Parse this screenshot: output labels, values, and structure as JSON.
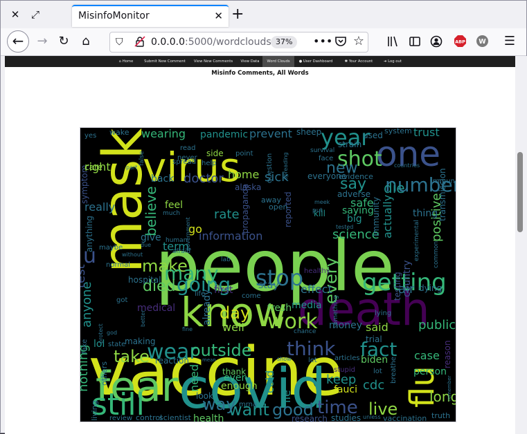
{
  "browser": {
    "tab_title": "MisinfoMonitor",
    "url_host": "0.0.0.0",
    "url_path": ":5000/wordclouds",
    "zoom": "37%",
    "icons": {
      "close_window": "close-icon",
      "restore": "restore-icon",
      "tab_close": "close-icon",
      "new_tab": "plus-icon",
      "back": "back-arrow-icon",
      "forward": "forward-arrow-icon",
      "reload": "reload-icon",
      "home": "home-icon",
      "shield": "shield-icon",
      "insecure": "insecure-lock-icon",
      "more": "more-dots-icon",
      "pocket": "pocket-icon",
      "bookmark": "star-icon",
      "library": "library-icon",
      "sidebar": "sidebar-icon",
      "account": "account-icon",
      "adblock": "adblock-icon",
      "extension": "extension-w-icon",
      "menu": "hamburger-menu-icon"
    },
    "adblock_label": "ABP",
    "extension_label": "W"
  },
  "site_nav": {
    "items": [
      {
        "label": "Home",
        "icon": "home-icon"
      },
      {
        "label": "Submit New Comment"
      },
      {
        "label": "View New Comments"
      },
      {
        "label": "View Data"
      },
      {
        "label": "Word Clouds",
        "active": true
      },
      {
        "label": "User Dashboard",
        "icon": "user-icon"
      },
      {
        "label": "Your Account",
        "icon": "gear-icon"
      },
      {
        "label": "Log out",
        "icon": "logout-icon"
      }
    ]
  },
  "page": {
    "heading": "Misinfo Comments, All Words"
  },
  "wordcloud": {
    "background": "#000000",
    "palette": [
      "#d2e21b",
      "#8fd744",
      "#35b779",
      "#21918c",
      "#2c728e",
      "#3b528b",
      "#472d7b",
      "#440154"
    ],
    "words": [
      {
        "text": "vaccine",
        "color": "#d2e21b"
      },
      {
        "text": "people",
        "color": "#7ad151"
      },
      {
        "text": "mask",
        "color": "#d2e21b"
      },
      {
        "text": "covid",
        "color": "#21918c"
      },
      {
        "text": "death",
        "color": "#440154"
      },
      {
        "text": "virus",
        "color": "#d2e21b"
      },
      {
        "text": "one",
        "color": "#3b528b"
      },
      {
        "text": "fear",
        "color": "#5ec962"
      },
      {
        "text": "know",
        "color": "#8fd744"
      },
      {
        "text": "still",
        "color": "#35b779"
      },
      {
        "text": "flu",
        "color": "#d2e21b"
      },
      {
        "text": "getting",
        "color": "#35b779"
      },
      {
        "text": "stop",
        "color": "#2c728e"
      },
      {
        "text": "going",
        "color": "#21918c"
      },
      {
        "text": "year",
        "color": "#21918c"
      },
      {
        "text": "shot",
        "color": "#5ec962"
      },
      {
        "text": "number",
        "color": "#2c728e"
      },
      {
        "text": "work",
        "color": "#8fd744"
      },
      {
        "text": "wear",
        "color": "#21918c"
      },
      {
        "text": "outside",
        "color": "#35b779"
      },
      {
        "text": "think",
        "color": "#3b528b"
      },
      {
        "text": "fact",
        "color": "#21918c"
      },
      {
        "text": "time",
        "color": "#3b528b"
      },
      {
        "text": "live",
        "color": "#8fd744"
      },
      {
        "text": "want",
        "color": "#21918c"
      },
      {
        "text": "good",
        "color": "#2c728e"
      },
      {
        "text": "way",
        "color": "#2c728e"
      },
      {
        "text": "long",
        "color": "#8fd744"
      },
      {
        "text": "make",
        "color": "#8fd744"
      },
      {
        "text": "many",
        "color": "#35b779"
      },
      {
        "text": "died",
        "color": "#5ec962"
      },
      {
        "text": "day",
        "color": "#d2e21b"
      },
      {
        "text": "take",
        "color": "#8fd744"
      },
      {
        "text": "new",
        "color": "#2c728e"
      },
      {
        "text": "say",
        "color": "#21918c"
      },
      {
        "text": "die",
        "color": "#21918c"
      },
      {
        "text": "believe",
        "color": "#35b779"
      },
      {
        "text": "right",
        "color": "#8fd744"
      },
      {
        "text": "sick",
        "color": "#2c728e"
      },
      {
        "text": "doctor",
        "color": "#3b528b"
      },
      {
        "text": "home",
        "color": "#8fd744"
      },
      {
        "text": "rate",
        "color": "#21918c"
      },
      {
        "text": "information",
        "color": "#3b528b"
      },
      {
        "text": "science",
        "color": "#35b779"
      },
      {
        "text": "every",
        "color": "#5ec962"
      },
      {
        "text": "keep",
        "color": "#21918c"
      },
      {
        "text": "safe",
        "color": "#35b779"
      },
      {
        "text": "positive",
        "color": "#5ec962"
      },
      {
        "text": "pandemic",
        "color": "#21918c"
      },
      {
        "text": "prevent",
        "color": "#2c728e"
      },
      {
        "text": "wearing",
        "color": "#35b779"
      },
      {
        "text": "trust",
        "color": "#21918c"
      },
      {
        "text": "cdc",
        "color": "#21918c"
      },
      {
        "text": "public",
        "color": "#35b779"
      },
      {
        "text": "case",
        "color": "#35b779"
      },
      {
        "text": "anyone",
        "color": "#21918c"
      },
      {
        "text": "nothing",
        "color": "#35b779"
      },
      {
        "text": "health",
        "color": "#5ec962"
      },
      {
        "text": "research",
        "color": "#3b528b"
      },
      {
        "text": "studies",
        "color": "#2c728e"
      },
      {
        "text": "vaccination",
        "color": "#2c728e"
      },
      {
        "text": "control",
        "color": "#2c728e"
      },
      {
        "text": "scientist",
        "color": "#2c728e"
      },
      {
        "text": "review",
        "color": "#2c728e"
      },
      {
        "text": "enough",
        "color": "#8fd744"
      },
      {
        "text": "even",
        "color": "#35b779"
      },
      {
        "text": "need",
        "color": "#35b779"
      },
      {
        "text": "go",
        "color": "#d2e21b"
      },
      {
        "text": "term",
        "color": "#21918c"
      },
      {
        "text": "air",
        "color": "#2c728e"
      },
      {
        "text": "said",
        "color": "#8fd744"
      },
      {
        "text": "money",
        "color": "#2c728e"
      },
      {
        "text": "fauci",
        "color": "#d2e21b"
      },
      {
        "text": "lie",
        "color": "#21918c"
      },
      {
        "text": "stay",
        "color": "#2c728e"
      },
      {
        "text": "well",
        "color": "#8fd744"
      },
      {
        "text": "first",
        "color": "#472d7b"
      },
      {
        "text": "really",
        "color": "#2c728e"
      },
      {
        "text": "test",
        "color": "#3b528b"
      },
      {
        "text": "lol",
        "color": "#21918c"
      },
      {
        "text": "u",
        "color": "#3b528b"
      },
      {
        "text": "effect",
        "color": "#2c728e"
      },
      {
        "text": "media",
        "color": "#21918c"
      },
      {
        "text": "fresh",
        "color": "#5ec962"
      },
      {
        "text": "cold",
        "color": "#21918c"
      },
      {
        "text": "thank",
        "color": "#5ec962"
      },
      {
        "text": "reaction",
        "color": "#2c728e"
      },
      {
        "text": "making",
        "color": "#2c728e"
      },
      {
        "text": "reason",
        "color": "#472d7b"
      },
      {
        "text": "truth",
        "color": "#2c728e"
      },
      {
        "text": "person",
        "color": "#35b779"
      },
      {
        "text": "biden",
        "color": "#5ec962"
      },
      {
        "text": "trial",
        "color": "#2c728e"
      },
      {
        "text": "country",
        "color": "#3b528b"
      },
      {
        "text": "testing",
        "color": "#3b528b"
      },
      {
        "text": "actually",
        "color": "#21918c"
      },
      {
        "text": "immunity",
        "color": "#2c728e"
      },
      {
        "text": "saying",
        "color": "#35b779"
      },
      {
        "text": "big",
        "color": "#21918c"
      },
      {
        "text": "thing",
        "color": "#2c728e"
      },
      {
        "text": "dying",
        "color": "#2c728e"
      },
      {
        "text": "symptom",
        "color": "#3b528b"
      },
      {
        "text": "anything",
        "color": "#2c728e"
      },
      {
        "text": "give",
        "color": "#2c728e"
      },
      {
        "text": "hospital",
        "color": "#2c728e"
      },
      {
        "text": "medical",
        "color": "#472d7b"
      },
      {
        "text": "already",
        "color": "#2c728e"
      },
      {
        "text": "propaganda",
        "color": "#3b528b"
      },
      {
        "text": "everyone",
        "color": "#2c728e"
      },
      {
        "text": "evidence",
        "color": "#2c728e"
      },
      {
        "text": "adverse",
        "color": "#2c728e"
      },
      {
        "text": "used",
        "color": "#2c728e"
      },
      {
        "text": "system",
        "color": "#2c728e"
      },
      {
        "text": "sheep",
        "color": "#2c728e"
      },
      {
        "text": "strain",
        "color": "#2c728e"
      },
      {
        "text": "care",
        "color": "#8fd744"
      },
      {
        "text": "wake",
        "color": "#2c728e"
      },
      {
        "text": "yes",
        "color": "#2c728e"
      },
      {
        "text": "back",
        "color": "#2c728e"
      },
      {
        "text": "feel",
        "color": "#8fd744"
      },
      {
        "text": "side",
        "color": "#8fd744"
      },
      {
        "text": "alaska",
        "color": "#3b528b"
      },
      {
        "text": "reported",
        "color": "#3b528b"
      },
      {
        "text": "kill",
        "color": "#21918c"
      },
      {
        "text": "away",
        "color": "#2c728e"
      },
      {
        "text": "open",
        "color": "#2c728e"
      },
      {
        "text": "transmission",
        "color": "#2c728e"
      },
      {
        "text": "immune",
        "color": "#2c728e"
      },
      {
        "text": "mrna",
        "color": "#2c728e"
      },
      {
        "text": "look",
        "color": "#2c728e"
      },
      {
        "text": "show",
        "color": "#2c728e"
      },
      {
        "text": "let",
        "color": "#2c728e"
      },
      {
        "text": "articles",
        "color": "#2c728e"
      },
      {
        "text": "stupid",
        "color": "#472d7b"
      },
      {
        "text": "lot",
        "color": "#2c728e"
      },
      {
        "text": "unless",
        "color": "#2c728e"
      },
      {
        "text": "chance",
        "color": "#2c728e"
      },
      {
        "text": "lying",
        "color": "#2c728e"
      },
      {
        "text": "breathe",
        "color": "#2c728e"
      },
      {
        "text": "living",
        "color": "#2c728e"
      },
      {
        "text": "others",
        "color": "#2c728e"
      },
      {
        "text": "state",
        "color": "#2c728e"
      },
      {
        "text": "fake",
        "color": "#2c728e"
      },
      {
        "text": "normal",
        "color": "#2c728e"
      },
      {
        "text": "maybe",
        "color": "#2c728e"
      },
      {
        "text": "life",
        "color": "#2c728e"
      },
      {
        "text": "come",
        "color": "#2c728e"
      },
      {
        "text": "point",
        "color": "#2c728e"
      },
      {
        "text": "help",
        "color": "#2c728e"
      },
      {
        "text": "spread",
        "color": "#2c728e"
      },
      {
        "text": "read",
        "color": "#2c728e"
      },
      {
        "text": "never",
        "color": "#2c728e"
      },
      {
        "text": "question",
        "color": "#2c728e"
      },
      {
        "text": "face",
        "color": "#2c728e"
      },
      {
        "text": "survival",
        "color": "#2c728e"
      },
      {
        "text": "healthy",
        "color": "#472d7b"
      },
      {
        "text": "lab",
        "color": "#2c728e"
      },
      {
        "text": "much",
        "color": "#2c728e"
      },
      {
        "text": "human",
        "color": "#2c728e"
      },
      {
        "text": "afraid",
        "color": "#2c728e"
      },
      {
        "text": "due",
        "color": "#2c728e"
      },
      {
        "text": "part",
        "color": "#2c728e"
      },
      {
        "text": "false",
        "color": "#2c728e"
      },
      {
        "text": "got",
        "color": "#2c728e"
      },
      {
        "text": "god",
        "color": "#2c728e"
      },
      {
        "text": "protect",
        "color": "#2c728e"
      },
      {
        "text": "fine",
        "color": "#2c728e"
      },
      {
        "text": "mean",
        "color": "#2c728e"
      },
      {
        "text": "meek",
        "color": "#2c728e"
      },
      {
        "text": "put",
        "color": "#2c728e"
      },
      {
        "text": "tested",
        "color": "#2c728e"
      },
      {
        "text": "spreading",
        "color": "#2c728e"
      },
      {
        "text": "something",
        "color": "#2c728e"
      },
      {
        "text": "experimental",
        "color": "#2c728e"
      },
      {
        "text": "common",
        "color": "#2c728e"
      },
      {
        "text": "countries",
        "color": "#2c728e"
      },
      {
        "text": "government",
        "color": "#2c728e"
      },
      {
        "text": "without",
        "color": "#2c728e"
      },
      {
        "text": "better",
        "color": "#2c728e"
      },
      {
        "text": "remember",
        "color": "#2c728e"
      }
    ]
  }
}
